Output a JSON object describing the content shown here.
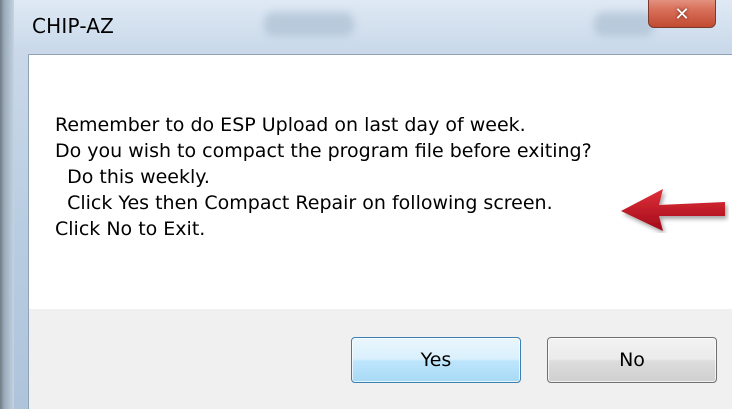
{
  "window": {
    "title": "CHIP-AZ",
    "close_glyph": "✕"
  },
  "message": {
    "lines": [
      "Remember to do ESP Upload on last day of week.",
      "Do you wish to compact the program file before exiting?",
      "  Do this weekly.",
      "  Click Yes then Compact Repair on following screen.",
      "Click No to Exit."
    ]
  },
  "buttons": {
    "yes_label": "Yes",
    "no_label": "No"
  },
  "annotation": {
    "arrow_icon": "red-arrow-left-icon",
    "arrow_color": "#c8102e"
  }
}
